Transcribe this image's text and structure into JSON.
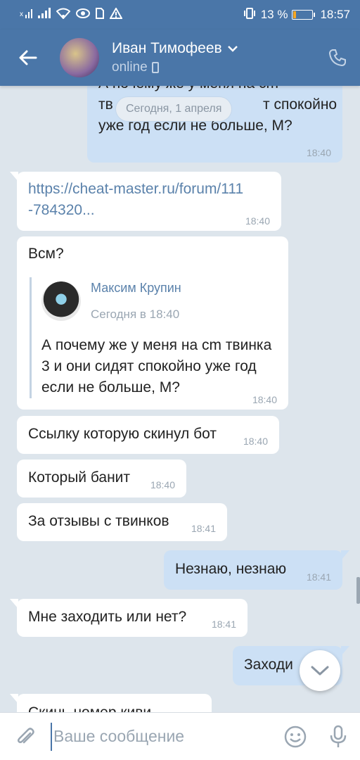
{
  "status_bar": {
    "battery_percent": "13 %",
    "battery_level": 0.13,
    "clock": "18:57"
  },
  "header": {
    "name": "Иван Тимофеев",
    "status": "online"
  },
  "date_divider": "Сегодня, 1 апреля",
  "messages": [
    {
      "direction": "out",
      "text_visible_line1": "А почему же у меня на cm",
      "text_line2_left": "тв",
      "text_line2_right": "т спокойно",
      "text_line3": "уже год если не больше, М?",
      "time": "18:40"
    },
    {
      "direction": "in",
      "link_line1": "https://cheat-master.ru/forum/111",
      "link_line2": "-784320...",
      "time": "18:40"
    },
    {
      "direction": "in",
      "text": "Всм?",
      "forward": {
        "author": "Максим Крупин",
        "date": "Сегодня в 18:40",
        "text": "А почему же у меня на cm твинка 3 и они сидят спокойно уже год если не больше, М?"
      },
      "time": "18:40"
    },
    {
      "direction": "in",
      "text": "Ссылку которую скинул бот",
      "time": "18:40"
    },
    {
      "direction": "in",
      "text": "Который банит",
      "time": "18:40"
    },
    {
      "direction": "in",
      "text": "За отзывы с твинков",
      "time": "18:41"
    },
    {
      "direction": "out",
      "text": "Незнаю, незнаю",
      "time": "18:41"
    },
    {
      "direction": "in",
      "text": "Мне заходить или нет?",
      "time": "18:41"
    },
    {
      "direction": "out",
      "text": "Заходи",
      "time": ""
    },
    {
      "direction": "in",
      "text": "Скинь номер киви",
      "time": ""
    }
  ],
  "composer": {
    "placeholder": "Ваше сообщение"
  },
  "colors": {
    "accent": "#4a76a8",
    "outgoing_bubble": "#cce0f5",
    "incoming_bubble": "#ffffff",
    "chat_bg": "#dde5ec"
  },
  "icons": [
    "signal-icon",
    "wifi-icon",
    "eye-icon",
    "alert-icon",
    "vibrate-icon",
    "back-arrow-icon",
    "chevron-down-icon",
    "phone-icon",
    "mobile-icon",
    "attach-icon",
    "emoji-icon",
    "mic-icon",
    "scroll-down-icon"
  ]
}
